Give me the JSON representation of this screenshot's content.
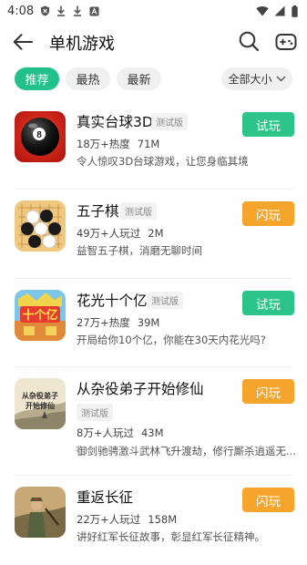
{
  "status_bar": {
    "time": "4:08",
    "left_icons": [
      "shield-icon",
      "download-icon",
      "download-icon",
      "a-notification-icon"
    ],
    "right_icons": [
      "wifi-icon",
      "signal-icon",
      "battery-icon"
    ]
  },
  "header": {
    "title": "单机游戏",
    "back_icon": "back-arrow-icon",
    "search_icon": "search-icon",
    "gamepad_icon": "gamepad-icon"
  },
  "filters": {
    "tabs": [
      {
        "label": "推荐",
        "active": true
      },
      {
        "label": "最热",
        "active": false
      },
      {
        "label": "最新",
        "active": false
      }
    ],
    "size_filter": "全部大小"
  },
  "colors": {
    "accent_green": "#22c08b",
    "try_button": "#2cc489",
    "flash_button": "#f6a52c"
  },
  "games": [
    {
      "name": "真实台球3D",
      "tag": "测试版",
      "stat_popularity": "18万+热度",
      "stat_size": "71M",
      "description": "令人惊叹3D台球游戏，让您身临其境",
      "button": "试玩",
      "button_type": "try",
      "icon": "billiard-8-ball-icon"
    },
    {
      "name": "五子棋",
      "tag": "测试版",
      "stat_popularity": "49万+人玩过",
      "stat_size": "2M",
      "description": "益智五子棋，消磨无聊时间",
      "button": "闪玩",
      "button_type": "flash",
      "icon": "gomoku-board-icon"
    },
    {
      "name": "花光十个亿",
      "tag": "测试版",
      "stat_popularity": "27万+热度",
      "stat_size": "39M",
      "description": "开局给你10个亿，你能在30天内花光吗?",
      "button": "试玩",
      "button_type": "try",
      "icon": "ten-billion-icon"
    },
    {
      "name": "从杂役弟子开始修仙",
      "tag": "测试版",
      "stat_popularity": "8万+人玩过",
      "stat_size": "43M",
      "description": "御剑驰骋激斗武林飞升渡劫，修行厮杀逍遥无...",
      "button": "闪玩",
      "button_type": "flash",
      "icon": "cultivation-scroll-icon"
    },
    {
      "name": "重返长征",
      "tag": "",
      "stat_popularity": "22万+人玩过",
      "stat_size": "158M",
      "description": "讲好红军长征故事，彰显红军长征精神。",
      "button": "闪玩",
      "button_type": "flash",
      "icon": "long-march-soldier-icon"
    }
  ]
}
